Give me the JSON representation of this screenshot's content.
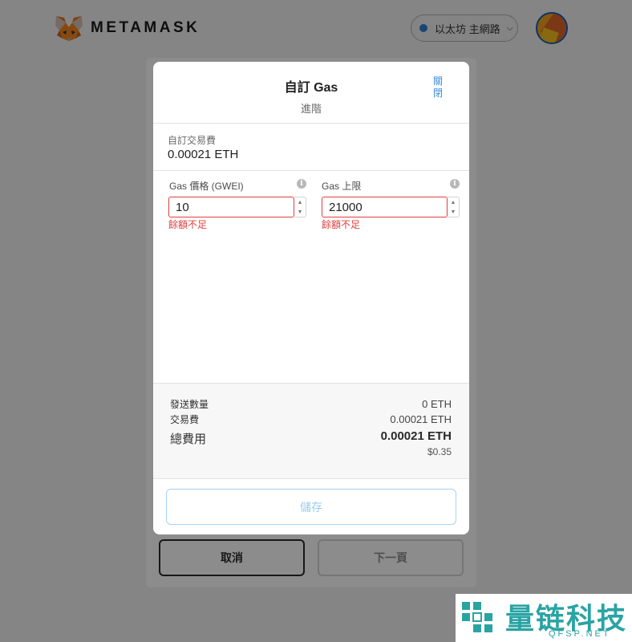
{
  "header": {
    "brand": "METAMASK",
    "network_label": "以太坊 主網路",
    "network_color": "#2f7fd1"
  },
  "background_actions": {
    "cancel_label": "取消",
    "next_label": "下一頁"
  },
  "modal": {
    "title": "自訂 Gas",
    "subtitle": "進階",
    "close_label": "關閉",
    "custom_fee_label": "自訂交易費",
    "custom_fee_value": "0.00021 ETH",
    "gas_price": {
      "label": "Gas 價格 (GWEI)",
      "value": "10",
      "error": "餘額不足"
    },
    "gas_limit": {
      "label": "Gas 上限",
      "value": "21000",
      "error": "餘額不足"
    },
    "summary": {
      "send_amount_label": "發送數量",
      "send_amount_value": "0 ETH",
      "tx_fee_label": "交易費",
      "tx_fee_value": "0.00021 ETH",
      "total_label": "總費用",
      "total_value": "0.00021 ETH",
      "total_usd": "$0.35"
    },
    "save_label": "儲存"
  },
  "watermark": {
    "text": "量链科技",
    "url": "QFSP.NET",
    "color": "#2aa3a3"
  },
  "colors": {
    "error": "#e03f3f",
    "link": "#3a8bd8",
    "save_border": "#a9d2f0"
  }
}
